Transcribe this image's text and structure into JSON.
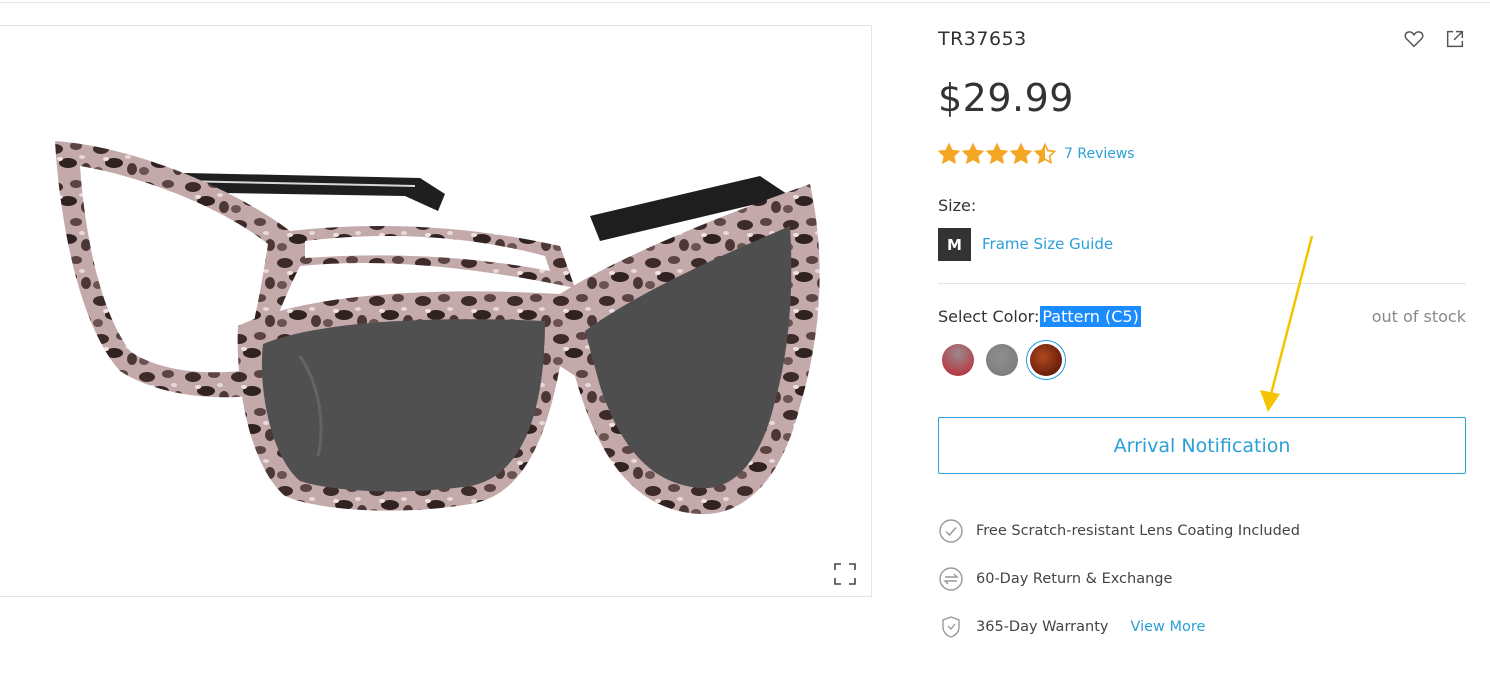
{
  "product": {
    "sku": "TR37653",
    "price": "$29.99",
    "rating_value": 4.5,
    "rating_max": 5,
    "reviews_label": "7 Reviews",
    "image_alt": "Cat-eye tortoise frame with clip-on sunglasses"
  },
  "size": {
    "label": "Size:",
    "selected": "M",
    "guide_label": "Frame Size Guide"
  },
  "color": {
    "label": "Select Color:",
    "selected_name": "Pattern (C5)",
    "stock_status": "out of stock",
    "swatches": [
      {
        "name": "red-gradient",
        "color": "#b5414a"
      },
      {
        "name": "grey",
        "color": "#808080"
      },
      {
        "name": "brown-pattern",
        "color": "#7a2a10",
        "selected": true
      }
    ]
  },
  "actions": {
    "notify_label": "Arrival Notification"
  },
  "benefits": [
    {
      "icon": "check-circle-icon",
      "label": "Free Scratch-resistant Lens Coating Included"
    },
    {
      "icon": "exchange-icon",
      "label": "60-Day Return & Exchange"
    },
    {
      "icon": "shield-icon",
      "label": "365-Day Warranty",
      "link": "View More"
    }
  ],
  "colors": {
    "accent": "#2a9fd8",
    "star": "#f5a623",
    "annotation_arrow": "#f5c400",
    "selection_highlight": "#1a8cff"
  }
}
